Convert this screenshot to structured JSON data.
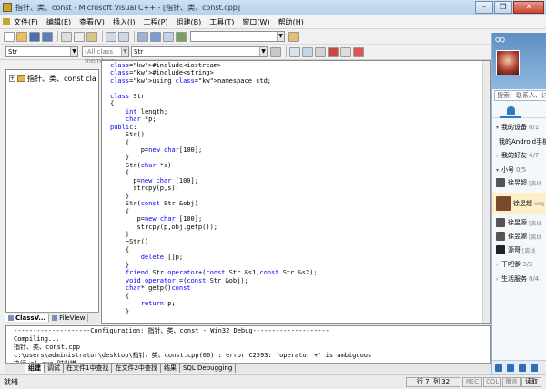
{
  "window": {
    "title": "指针、类、const - Microsoft Visual C++ - [指针、类、const.cpp]",
    "controls": {
      "minimize": "–",
      "restore": "❐",
      "close": "✕"
    }
  },
  "menu": [
    "文件(F)",
    "编辑(E)",
    "查看(V)",
    "插入(I)",
    "工程(P)",
    "组建(B)",
    "工具(T)",
    "窗口(W)",
    "帮助(H)"
  ],
  "toolbar2": {
    "class_combo": "Str",
    "members_combo": "(All class members)",
    "function_combo": "Str"
  },
  "workspace": {
    "tree_item": "指针、类、const cla",
    "tabs": [
      "ClassV...",
      "FileView"
    ]
  },
  "editor": {
    "lines": [
      "#include<iostream>",
      "#include<string>",
      "using namespace std;",
      "",
      "class Str",
      "{",
      "    int length;",
      "    char *p;",
      "public:",
      "    Str()",
      "    {",
      "        p=new char[100];",
      "    }",
      "    Str(char *s)",
      "    {",
      "      p=new char [100];",
      "      strcpy(p,s);",
      "    }",
      "    Str(const Str &obj)",
      "    {",
      "       p=new char [100];",
      "       strcpy(p,obj.getp());",
      "    }",
      "    ~Str()",
      "    {",
      "        delete []p;",
      "    }",
      "    friend Str operator+(const Str &s1,const Str &s2);",
      "    void operator =(const Str &obj);",
      "    char* getp()const",
      "    {",
      "        return p;",
      "    }"
    ]
  },
  "output": {
    "lines": [
      "--------------------Configuration: 指针、类、const - Win32 Debug--------------------",
      "Compiling...",
      "指针、类、const.cpp",
      "c:\\users\\administrator\\desktop\\指针、类、const.cpp(66) : error C2593: 'operator +' is ambiguous",
      "执行 cl.exe 时出错."
    ],
    "tabs": [
      "组建",
      "调试",
      "在文件1中查找",
      "在文件2中查找",
      "结果",
      "SQL Debugging"
    ]
  },
  "status": {
    "ready": "就绪",
    "position": "行 7, 列 32",
    "indicators": [
      "REC",
      "COL",
      "覆盖",
      "读取"
    ]
  },
  "qq": {
    "brand": "QQ",
    "search_placeholder": "搜索：联系人、讨论组",
    "groups": [
      {
        "label": "我的设备",
        "count": "0/1"
      },
      {
        "label": "我的Android手机",
        "count": ""
      },
      {
        "label": "我的好友",
        "count": "4/7"
      },
      {
        "label": "小号",
        "count": "0/5"
      },
      {
        "label": "徐昱超",
        "count": "[离线"
      },
      {
        "label": "徐昱超",
        "count": "xxq"
      },
      {
        "label": "徐昱源",
        "count": "[离线"
      },
      {
        "label": "徐昱源",
        "count": "[离线"
      },
      {
        "label": "源哥",
        "count": "[离线"
      },
      {
        "label": "干吧爹",
        "count": "3/3"
      },
      {
        "label": "生活服务",
        "count": "0/4"
      }
    ]
  }
}
